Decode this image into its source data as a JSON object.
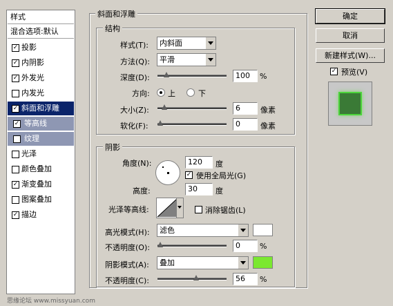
{
  "sidebar": {
    "header": "样式",
    "blend": "混合选项:默认",
    "items": [
      {
        "label": "投影",
        "checked": true
      },
      {
        "label": "内阴影",
        "checked": true
      },
      {
        "label": "外发光",
        "checked": true
      },
      {
        "label": "内发光",
        "checked": false
      },
      {
        "label": "斜面和浮雕",
        "checked": true,
        "selected": true
      },
      {
        "label": "等高线",
        "checked": true,
        "sub": true
      },
      {
        "label": "纹理",
        "checked": false,
        "sub": true
      },
      {
        "label": "光泽",
        "checked": false
      },
      {
        "label": "颜色叠加",
        "checked": false
      },
      {
        "label": "渐变叠加",
        "checked": true
      },
      {
        "label": "图案叠加",
        "checked": false
      },
      {
        "label": "描边",
        "checked": true
      }
    ]
  },
  "bevel": {
    "section_title": "斜面和浮雕",
    "structure": {
      "title": "结构",
      "style_label": "样式(T):",
      "style_value": "内斜面",
      "technique_label": "方法(Q):",
      "technique_value": "平滑",
      "depth_label": "深度(D):",
      "depth_value": "100",
      "depth_unit": "%",
      "depth_level": 0.1,
      "direction_label": "方向:",
      "dir_up": "上",
      "dir_down": "下",
      "size_label": "大小(Z):",
      "size_value": "6",
      "size_unit": "像素",
      "size_level": 0.06,
      "soften_label": "软化(F):",
      "soften_value": "0",
      "soften_unit": "像素",
      "soften_level": 0.0
    },
    "shading": {
      "title": "阴影",
      "angle_label": "角度(N):",
      "angle_value": "120",
      "angle_unit": "度",
      "global_light_label": "使用全局光(G)",
      "altitude_label": "高度:",
      "altitude_value": "30",
      "altitude_unit": "度",
      "gloss_label": "光泽等高线:",
      "antialias_label": "消除锯齿(L)",
      "highlight_mode_label": "高光模式(H):",
      "highlight_mode_value": "滤色",
      "highlight_color": "#ffffff",
      "opacity1_label": "不透明度(O):",
      "opacity1_value": "0",
      "opacity1_unit": "%",
      "opacity1_level": 0.0,
      "shadow_mode_label": "阴影模式(A):",
      "shadow_mode_value": "叠加",
      "shadow_color": "#7be830",
      "opacity2_label": "不透明度(C):",
      "opacity2_value": "56",
      "opacity2_unit": "%",
      "opacity2_level": 0.56
    }
  },
  "buttons": {
    "ok": "确定",
    "cancel": "取消",
    "new_style": "新建样式(W)...",
    "preview": "预览(V)"
  },
  "watermark": "思缘论坛 www.missyuan.com"
}
